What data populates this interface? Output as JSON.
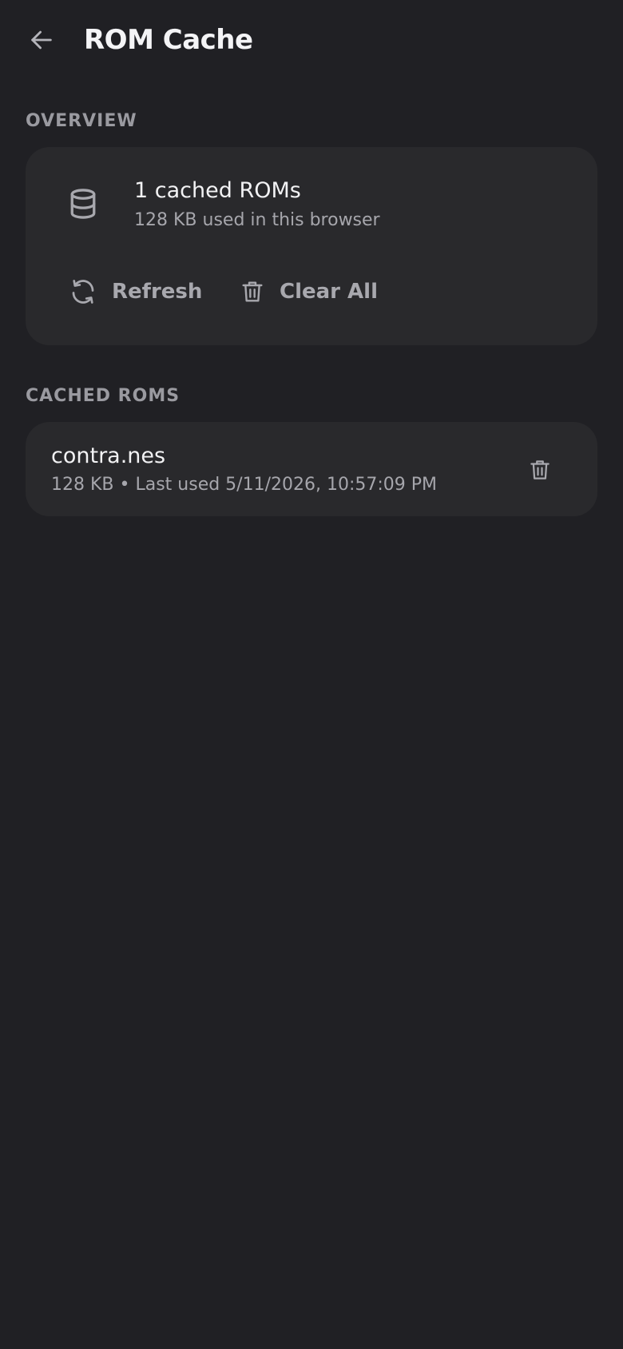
{
  "header": {
    "title": "ROM Cache",
    "back_icon": "arrow-left-icon"
  },
  "overview": {
    "section_label": "OVERVIEW",
    "icon": "database-icon",
    "count_text": "1 cached ROMs",
    "usage_text": "128 KB used in this browser",
    "refresh_label": "Refresh",
    "refresh_icon": "refresh-icon",
    "clear_all_label": "Clear All",
    "clear_all_icon": "trash-icon"
  },
  "cached_roms": {
    "section_label": "CACHED ROMS",
    "items": [
      {
        "name": "contra.nes",
        "meta": "128 KB • Last used 5/11/2026, 10:57:09 PM",
        "delete_icon": "trash-icon"
      }
    ]
  },
  "colors": {
    "background": "#202024",
    "card": "#29292c",
    "primary_text": "#f2f2f4",
    "secondary_text": "#a6a6ac",
    "section_label": "#9a9aa0"
  }
}
